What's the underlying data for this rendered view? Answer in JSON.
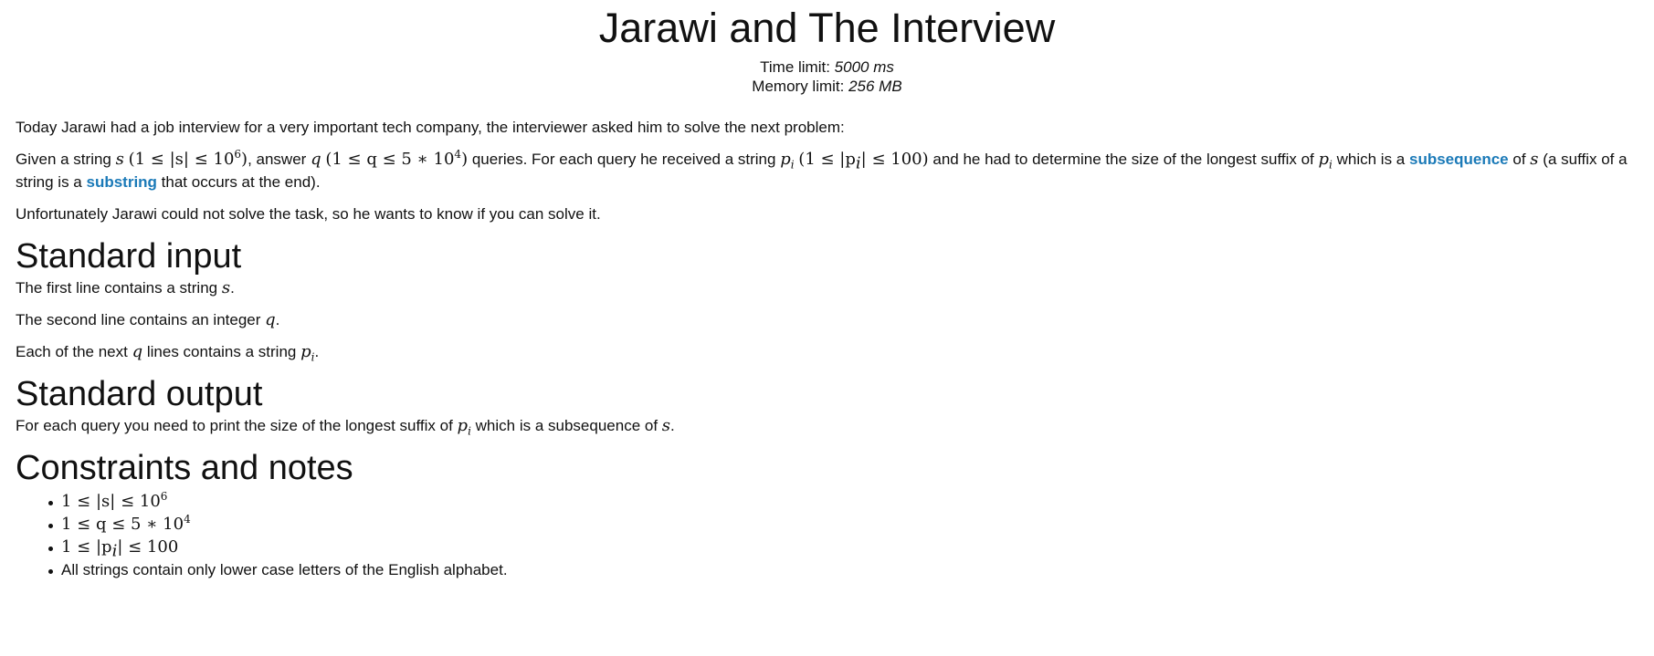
{
  "problem": {
    "title": "Jarawi and The Interview",
    "time_limit_label": "Time limit:",
    "time_limit_value": "5000 ms",
    "memory_limit_label": "Memory limit:",
    "memory_limit_value": "256 MB"
  },
  "statement": {
    "intro": "Today Jarawi had a job interview for a very important tech company, the interviewer asked him to solve the next problem:",
    "given_a_string": "Given a string",
    "answer": ", answer",
    "queries_text": "queries. For each query he received a string",
    "determine_text": "and he had to determine the size of the longest suffix of",
    "which_is_a": "which is a",
    "subsequence_link": "subsequence",
    "of": "of",
    "suffix_note_start": "(a suffix of a string is a",
    "substring_link": "substring",
    "suffix_note_end": "that occurs at the end).",
    "unfortunately": "Unfortunately Jarawi could not solve the task, so he wants to know if you can solve it."
  },
  "math": {
    "s": "s",
    "q": "q",
    "p": "p",
    "i": "i",
    "s_bound": "(1 ≤ |s| ≤ 10",
    "s_exp": "6",
    "close_paren": ")",
    "q_bound": "(1 ≤ q ≤ 5 ∗ 10",
    "q_exp": "4",
    "p_bound_open": "(1 ≤ |p",
    "p_bound_close": "| ≤ 100)"
  },
  "input": {
    "heading": "Standard input",
    "line1_text": "The first line contains a string",
    "line2_text": "The second line contains an integer",
    "line3_text_a": "Each of the next",
    "line3_text_b": "lines contains a string",
    "period": "."
  },
  "output": {
    "heading": "Standard output",
    "text_a": "For each query you need to print the size of the longest suffix of",
    "text_b": "which is a subsequence of"
  },
  "constraints": {
    "heading": "Constraints and notes",
    "c1": "1 ≤ |s| ≤ 10",
    "c1_exp": "6",
    "c2": "1 ≤ q ≤ 5 ∗ 10",
    "c2_exp": "4",
    "c3_open": "1 ≤ |p",
    "c3_close": "| ≤ 100",
    "c4": "All strings contain only lower case letters of the English alphabet."
  }
}
